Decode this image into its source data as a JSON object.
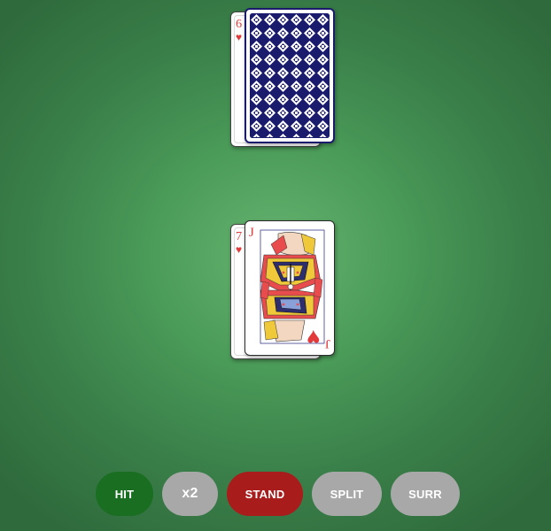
{
  "dealer_hand": {
    "cards": [
      {
        "rank": "6",
        "suit": "♥",
        "face_up": true
      },
      {
        "rank": "",
        "suit": "",
        "face_up": false
      }
    ]
  },
  "player_hand": {
    "cards": [
      {
        "rank": "7",
        "suit": "♥",
        "face_up": true
      },
      {
        "rank": "J",
        "suit": "♥",
        "face_up": true
      }
    ]
  },
  "colors": {
    "felt": "#4a9a58",
    "card_back": "#1b1b6e",
    "heart": "#e23a3a",
    "hit": "#1a6e22",
    "stand": "#a81c1c",
    "disabled": "#a8a8a8"
  },
  "actions": {
    "hit_label": "HIT",
    "double_label": "x2",
    "stand_label": "STAND",
    "split_label": "SPLIT",
    "surrender_label": "SURR"
  }
}
